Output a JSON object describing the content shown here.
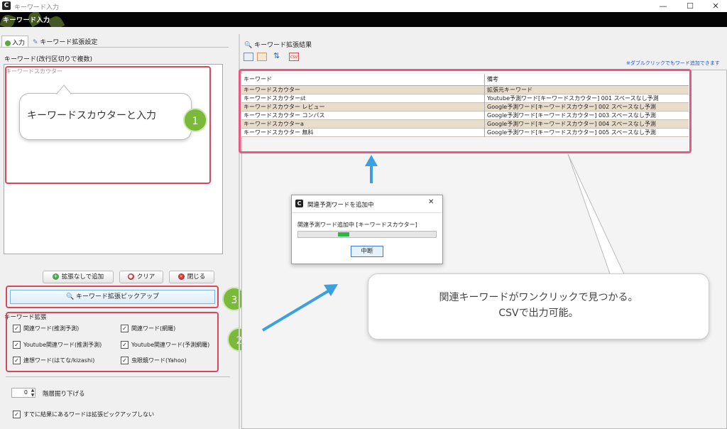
{
  "window": {
    "title": "キーワード入力",
    "banner_title": "キーワード入力",
    "controls": {
      "minimize": "—",
      "maximize": "☐",
      "close": "✕"
    }
  },
  "left": {
    "tabs": [
      {
        "label": "入力",
        "icon": "green-circle-icon"
      },
      {
        "label": "キーワード拡張設定",
        "icon": "wrench-icon"
      }
    ],
    "keyword_label": "キーワード(改行区切りで複数)",
    "textarea_placeholder": "キーワードスカウター",
    "bubble_text": "キーワードスカウターと入力",
    "buttons": {
      "add_without_expand": "拡張なしで追加",
      "clear": "クリア",
      "close": "閉じる",
      "pickup": "キーワード拡張ピックアップ"
    },
    "expand_section_label": "キーワード拡張",
    "checkboxes": [
      {
        "label": "関連ワード(推測予測)",
        "checked": true
      },
      {
        "label": "関連ワード(網羅)",
        "checked": true
      },
      {
        "label": "Youtube関連ワード(推測予測)",
        "checked": true
      },
      {
        "label": "Youtube関連ワード(予測網羅)",
        "checked": true
      },
      {
        "label": "連想ワード(はてな/kizashi)",
        "checked": true
      },
      {
        "label": "虫眼鏡ワード(Yahoo)",
        "checked": true
      }
    ],
    "depth_value": "0",
    "depth_label": "階層掘り下げる",
    "skip_checkbox": {
      "label": "すでに結果にあるワードは拡張ピックアップしない",
      "checked": true
    }
  },
  "right": {
    "section_title": "キーワード拡張結果",
    "dblclick_hint": "※ダブルクリックでもワード追加できます",
    "toolbar_icons": [
      "table-icon",
      "list-icon",
      "sort-icon",
      "csv-export-icon"
    ],
    "table": {
      "headers": [
        "キーワード",
        "備考"
      ],
      "rows": [
        [
          "キーワードスカウター",
          "拡張元キーワード"
        ],
        [
          "キーワードスカウターst",
          "Youtube予測ワード[キーワードスカウター] 001 スペースなし予測"
        ],
        [
          "キーワードスカウター レビュー",
          "Google予測ワード[キーワードスカウター] 002 スペースなし予測"
        ],
        [
          "キーワードスカウター コンパス",
          "Google予測ワード[キーワードスカウター] 003 スペースなし予測"
        ],
        [
          "キーワードスカウターa",
          "Google予測ワード[キーワードスカウター] 004 スペースなし予測"
        ],
        [
          "キーワードスカウター 無料",
          "Google予測ワード[キーワードスカウター] 005 スペースなし予測"
        ]
      ]
    }
  },
  "dialog": {
    "title": "関連予測ワードを追加中",
    "message": "関連予測ワード追加中 [キーワードスカウター]",
    "progress": 0.08,
    "cancel_label": "中断",
    "close": "✕"
  },
  "callout": {
    "line1": "関連キーワードがワンクリックで見つかる。",
    "line2": "CSVで出力可能。"
  },
  "step_numbers": [
    "1",
    "2",
    "3"
  ],
  "colors": {
    "accent_green": "#7bb93a",
    "highlight_red": "#d8485c",
    "highlight_pink": "#e45a82",
    "arrow_blue": "#3aa0e0"
  }
}
